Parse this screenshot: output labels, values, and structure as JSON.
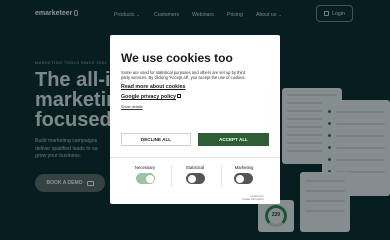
{
  "nav": {
    "logo": "emarketeer",
    "items": [
      {
        "label": "Products",
        "has_dropdown": true
      },
      {
        "label": "Customers",
        "has_dropdown": false
      },
      {
        "label": "Webinars",
        "has_dropdown": false
      },
      {
        "label": "Pricing",
        "has_dropdown": false
      },
      {
        "label": "About us",
        "has_dropdown": true
      }
    ],
    "login_label": "Login"
  },
  "hero": {
    "eyebrow": "MARKETING TOOLS SINCE 2002",
    "title_lines": [
      "The all-in",
      "marketing",
      "focused"
    ],
    "subtitle_lines": [
      "Build marketing campaigns",
      "deliver qualified leads to sa",
      "grow your business."
    ],
    "demo_button": "BOOK A DEMO"
  },
  "preview": {
    "gauge_value": "220"
  },
  "cookie_dialog": {
    "title": "We use cookies too",
    "body_lines": [
      "Some are used for statistical purposes and others are set up by third",
      "party services. By clicking 'Accept all', you accept the use of cookies."
    ],
    "read_more": "Read more about cookies",
    "google_privacy": "Google privacy policy",
    "show_details": "Show details",
    "decline_label": "DECLINE ALL",
    "accept_label": "ACCEPT ALL",
    "toggles": [
      {
        "label": "Necessary",
        "state": "on",
        "disabled": true
      },
      {
        "label": "Statistical",
        "state": "off",
        "disabled": false
      },
      {
        "label": "Marketing",
        "state": "off",
        "disabled": false
      }
    ],
    "powered_by_1": "powered by",
    "powered_by_2": "Cookie Information"
  },
  "colors": {
    "background": "#0c2a2d",
    "accept_button": "#2f5d34",
    "toggle_on": "#9fc3a2",
    "toggle_off": "#555555"
  },
  "icons": [
    "login-icon",
    "external-link-icon",
    "monitor-icon",
    "chevron-down-icon"
  ]
}
